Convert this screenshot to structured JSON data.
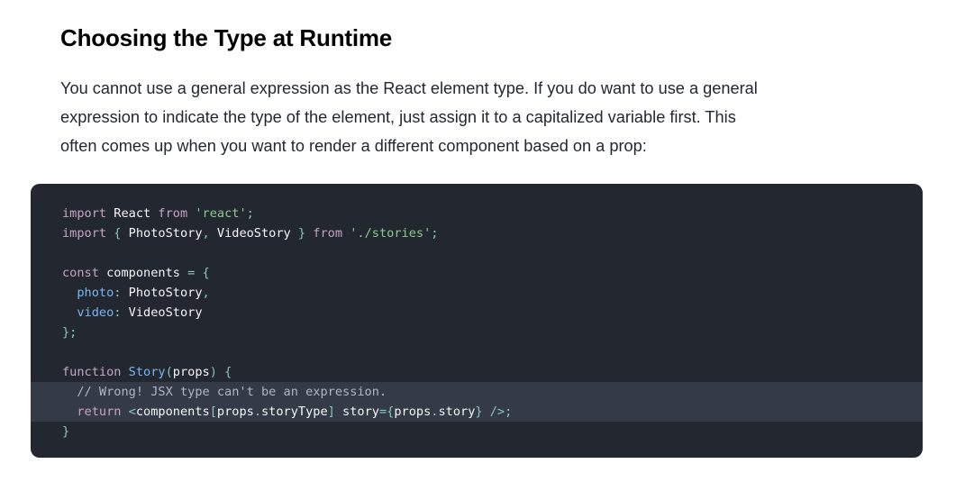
{
  "section": {
    "title": "Choosing the Type at Runtime",
    "intro_lines": [
      "You cannot use a general expression as the React element type. If you do want to use a general",
      "expression to indicate the type of the element, just assign it to a capitalized variable first. This",
      "often comes up when you want to render a different component based on a prop:"
    ]
  },
  "code": {
    "language": "jsx",
    "highlighted_lines": [
      10,
      11
    ],
    "lines": [
      [
        {
          "t": "kw",
          "v": "import"
        },
        {
          "t": "plain",
          "v": " React "
        },
        {
          "t": "kw",
          "v": "from"
        },
        {
          "t": "plain",
          "v": " "
        },
        {
          "t": "str",
          "v": "'react'"
        },
        {
          "t": "punc",
          "v": ";"
        }
      ],
      [
        {
          "t": "kw",
          "v": "import"
        },
        {
          "t": "plain",
          "v": " "
        },
        {
          "t": "punc",
          "v": "{"
        },
        {
          "t": "plain",
          "v": " PhotoStory"
        },
        {
          "t": "punc",
          "v": ","
        },
        {
          "t": "plain",
          "v": " VideoStory "
        },
        {
          "t": "punc",
          "v": "}"
        },
        {
          "t": "plain",
          "v": " "
        },
        {
          "t": "kw",
          "v": "from"
        },
        {
          "t": "plain",
          "v": " "
        },
        {
          "t": "str",
          "v": "'./stories'"
        },
        {
          "t": "punc",
          "v": ";"
        }
      ],
      [],
      [
        {
          "t": "kw",
          "v": "const"
        },
        {
          "t": "plain",
          "v": " components "
        },
        {
          "t": "punc",
          "v": "="
        },
        {
          "t": "plain",
          "v": " "
        },
        {
          "t": "punc",
          "v": "{"
        }
      ],
      [
        {
          "t": "plain",
          "v": "  "
        },
        {
          "t": "prop",
          "v": "photo"
        },
        {
          "t": "punc",
          "v": ":"
        },
        {
          "t": "plain",
          "v": " PhotoStory"
        },
        {
          "t": "punc",
          "v": ","
        }
      ],
      [
        {
          "t": "plain",
          "v": "  "
        },
        {
          "t": "prop",
          "v": "video"
        },
        {
          "t": "punc",
          "v": ":"
        },
        {
          "t": "plain",
          "v": " VideoStory"
        }
      ],
      [
        {
          "t": "punc",
          "v": "};"
        }
      ],
      [],
      [
        {
          "t": "kw",
          "v": "function"
        },
        {
          "t": "plain",
          "v": " "
        },
        {
          "t": "fn",
          "v": "Story"
        },
        {
          "t": "punc",
          "v": "("
        },
        {
          "t": "plain",
          "v": "props"
        },
        {
          "t": "punc",
          "v": ")"
        },
        {
          "t": "plain",
          "v": " "
        },
        {
          "t": "punc",
          "v": "{"
        }
      ],
      [
        {
          "t": "plain",
          "v": "  "
        },
        {
          "t": "com",
          "v": "// Wrong! JSX type can't be an expression."
        }
      ],
      [
        {
          "t": "plain",
          "v": "  "
        },
        {
          "t": "kw",
          "v": "return"
        },
        {
          "t": "plain",
          "v": " "
        },
        {
          "t": "punc",
          "v": "<"
        },
        {
          "t": "plain",
          "v": "components"
        },
        {
          "t": "punc",
          "v": "["
        },
        {
          "t": "plain",
          "v": "props"
        },
        {
          "t": "punc",
          "v": "."
        },
        {
          "t": "plain",
          "v": "storyType"
        },
        {
          "t": "punc",
          "v": "]"
        },
        {
          "t": "plain",
          "v": " story"
        },
        {
          "t": "punc",
          "v": "={"
        },
        {
          "t": "plain",
          "v": "props"
        },
        {
          "t": "punc",
          "v": "."
        },
        {
          "t": "plain",
          "v": "story"
        },
        {
          "t": "punc",
          "v": "}"
        },
        {
          "t": "plain",
          "v": " "
        },
        {
          "t": "punc",
          "v": "/>;"
        }
      ],
      [
        {
          "t": "punc",
          "v": "}"
        }
      ]
    ]
  }
}
